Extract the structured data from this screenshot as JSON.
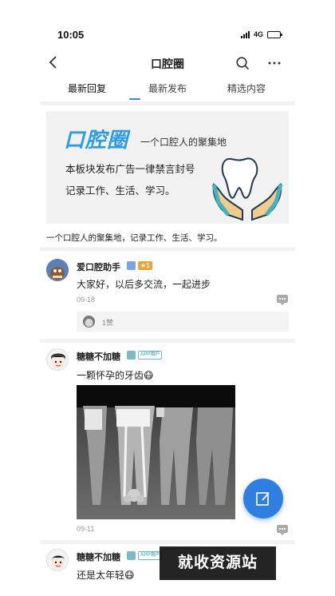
{
  "status_bar": {
    "time": "10:05",
    "network": "4G"
  },
  "nav": {
    "title": "口腔圈"
  },
  "tabs": [
    {
      "label": "最新回复",
      "active": true
    },
    {
      "label": "最新发布",
      "active": false
    },
    {
      "label": "精选内容",
      "active": false
    }
  ],
  "banner": {
    "logo": "口腔圈",
    "tagline": "一个口腔人的聚集地",
    "notice": "本板块发布广告一律禁言封号",
    "slogan": "记录工作、生活、学习。"
  },
  "intro": "一个口腔人的聚集地，记录工作、生活、学习。",
  "posts": [
    {
      "author": "爱口腔助手",
      "level_badge": "★1",
      "text": "大家好，以后多交流，一起进步",
      "date": "09-18",
      "likes": "1赞"
    },
    {
      "author": "糖糖不加糖",
      "app_badge": "APP用户",
      "text": "一颗怀孕的牙齿😷",
      "date": "09-11"
    },
    {
      "author": "糖糖不加糖",
      "app_badge": "APP用户",
      "text": "还是太年轻😷"
    }
  ],
  "watermark": "就收资源站",
  "colors": {
    "accent": "#2f7fe0",
    "logo": "#2f9be0",
    "level_badge": "#f0a23b"
  },
  "icons": [
    "back-arrow-icon",
    "search-icon",
    "more-icon",
    "reply-icon",
    "edit-icon"
  ]
}
